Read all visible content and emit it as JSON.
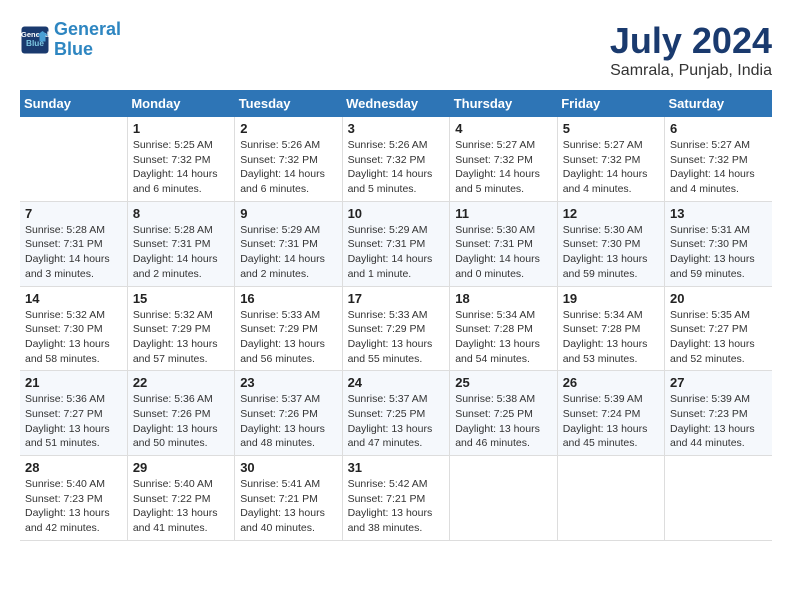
{
  "header": {
    "logo_line1": "General",
    "logo_line2": "Blue",
    "month_year": "July 2024",
    "location": "Samrala, Punjab, India"
  },
  "columns": [
    "Sunday",
    "Monday",
    "Tuesday",
    "Wednesday",
    "Thursday",
    "Friday",
    "Saturday"
  ],
  "weeks": [
    [
      {
        "day": "",
        "info": ""
      },
      {
        "day": "1",
        "info": "Sunrise: 5:25 AM\nSunset: 7:32 PM\nDaylight: 14 hours\nand 6 minutes."
      },
      {
        "day": "2",
        "info": "Sunrise: 5:26 AM\nSunset: 7:32 PM\nDaylight: 14 hours\nand 6 minutes."
      },
      {
        "day": "3",
        "info": "Sunrise: 5:26 AM\nSunset: 7:32 PM\nDaylight: 14 hours\nand 5 minutes."
      },
      {
        "day": "4",
        "info": "Sunrise: 5:27 AM\nSunset: 7:32 PM\nDaylight: 14 hours\nand 5 minutes."
      },
      {
        "day": "5",
        "info": "Sunrise: 5:27 AM\nSunset: 7:32 PM\nDaylight: 14 hours\nand 4 minutes."
      },
      {
        "day": "6",
        "info": "Sunrise: 5:27 AM\nSunset: 7:32 PM\nDaylight: 14 hours\nand 4 minutes."
      }
    ],
    [
      {
        "day": "7",
        "info": "Sunrise: 5:28 AM\nSunset: 7:31 PM\nDaylight: 14 hours\nand 3 minutes."
      },
      {
        "day": "8",
        "info": "Sunrise: 5:28 AM\nSunset: 7:31 PM\nDaylight: 14 hours\nand 2 minutes."
      },
      {
        "day": "9",
        "info": "Sunrise: 5:29 AM\nSunset: 7:31 PM\nDaylight: 14 hours\nand 2 minutes."
      },
      {
        "day": "10",
        "info": "Sunrise: 5:29 AM\nSunset: 7:31 PM\nDaylight: 14 hours\nand 1 minute."
      },
      {
        "day": "11",
        "info": "Sunrise: 5:30 AM\nSunset: 7:31 PM\nDaylight: 14 hours\nand 0 minutes."
      },
      {
        "day": "12",
        "info": "Sunrise: 5:30 AM\nSunset: 7:30 PM\nDaylight: 13 hours\nand 59 minutes."
      },
      {
        "day": "13",
        "info": "Sunrise: 5:31 AM\nSunset: 7:30 PM\nDaylight: 13 hours\nand 59 minutes."
      }
    ],
    [
      {
        "day": "14",
        "info": "Sunrise: 5:32 AM\nSunset: 7:30 PM\nDaylight: 13 hours\nand 58 minutes."
      },
      {
        "day": "15",
        "info": "Sunrise: 5:32 AM\nSunset: 7:29 PM\nDaylight: 13 hours\nand 57 minutes."
      },
      {
        "day": "16",
        "info": "Sunrise: 5:33 AM\nSunset: 7:29 PM\nDaylight: 13 hours\nand 56 minutes."
      },
      {
        "day": "17",
        "info": "Sunrise: 5:33 AM\nSunset: 7:29 PM\nDaylight: 13 hours\nand 55 minutes."
      },
      {
        "day": "18",
        "info": "Sunrise: 5:34 AM\nSunset: 7:28 PM\nDaylight: 13 hours\nand 54 minutes."
      },
      {
        "day": "19",
        "info": "Sunrise: 5:34 AM\nSunset: 7:28 PM\nDaylight: 13 hours\nand 53 minutes."
      },
      {
        "day": "20",
        "info": "Sunrise: 5:35 AM\nSunset: 7:27 PM\nDaylight: 13 hours\nand 52 minutes."
      }
    ],
    [
      {
        "day": "21",
        "info": "Sunrise: 5:36 AM\nSunset: 7:27 PM\nDaylight: 13 hours\nand 51 minutes."
      },
      {
        "day": "22",
        "info": "Sunrise: 5:36 AM\nSunset: 7:26 PM\nDaylight: 13 hours\nand 50 minutes."
      },
      {
        "day": "23",
        "info": "Sunrise: 5:37 AM\nSunset: 7:26 PM\nDaylight: 13 hours\nand 48 minutes."
      },
      {
        "day": "24",
        "info": "Sunrise: 5:37 AM\nSunset: 7:25 PM\nDaylight: 13 hours\nand 47 minutes."
      },
      {
        "day": "25",
        "info": "Sunrise: 5:38 AM\nSunset: 7:25 PM\nDaylight: 13 hours\nand 46 minutes."
      },
      {
        "day": "26",
        "info": "Sunrise: 5:39 AM\nSunset: 7:24 PM\nDaylight: 13 hours\nand 45 minutes."
      },
      {
        "day": "27",
        "info": "Sunrise: 5:39 AM\nSunset: 7:23 PM\nDaylight: 13 hours\nand 44 minutes."
      }
    ],
    [
      {
        "day": "28",
        "info": "Sunrise: 5:40 AM\nSunset: 7:23 PM\nDaylight: 13 hours\nand 42 minutes."
      },
      {
        "day": "29",
        "info": "Sunrise: 5:40 AM\nSunset: 7:22 PM\nDaylight: 13 hours\nand 41 minutes."
      },
      {
        "day": "30",
        "info": "Sunrise: 5:41 AM\nSunset: 7:21 PM\nDaylight: 13 hours\nand 40 minutes."
      },
      {
        "day": "31",
        "info": "Sunrise: 5:42 AM\nSunset: 7:21 PM\nDaylight: 13 hours\nand 38 minutes."
      },
      {
        "day": "",
        "info": ""
      },
      {
        "day": "",
        "info": ""
      },
      {
        "day": "",
        "info": ""
      }
    ]
  ]
}
